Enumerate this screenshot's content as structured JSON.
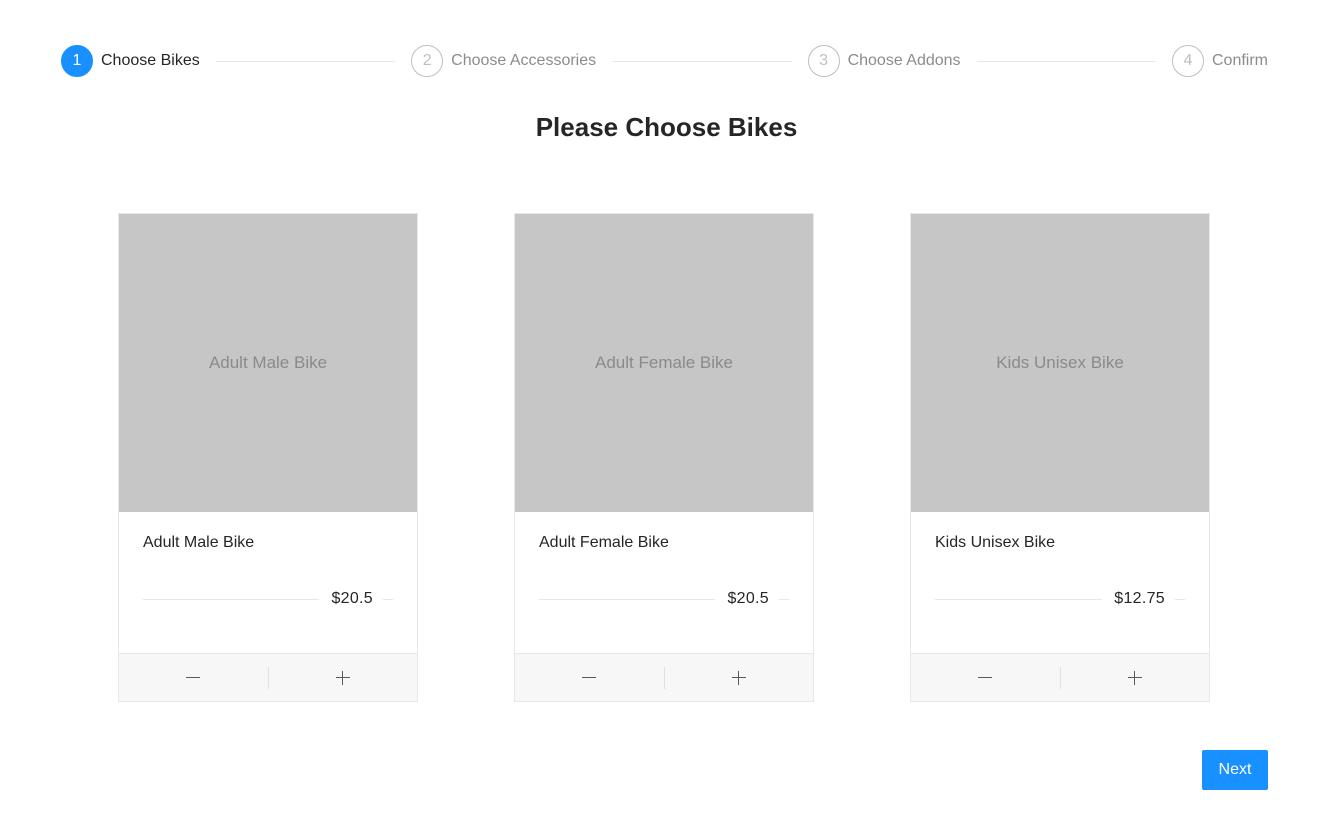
{
  "steps": [
    {
      "number": "1",
      "title": "Choose Bikes",
      "status": "active"
    },
    {
      "number": "2",
      "title": "Choose Accessories",
      "status": "wait"
    },
    {
      "number": "3",
      "title": "Choose Addons",
      "status": "wait"
    },
    {
      "number": "4",
      "title": "Confirm",
      "status": "wait"
    }
  ],
  "page_title": "Please Choose Bikes",
  "products": [
    {
      "image_text": "Adult Male Bike",
      "name": "Adult Male Bike",
      "price": "$20.5"
    },
    {
      "image_text": "Adult Female Bike",
      "name": "Adult Female Bike",
      "price": "$20.5"
    },
    {
      "image_text": "Kids Unisex Bike",
      "name": "Kids Unisex Bike",
      "price": "$12.75"
    }
  ],
  "actions": {
    "decrease_icon": "minus-icon",
    "increase_icon": "plus-icon"
  },
  "next_label": "Next",
  "colors": {
    "primary": "#1890ff",
    "placeholder": "#c6c6c6"
  }
}
